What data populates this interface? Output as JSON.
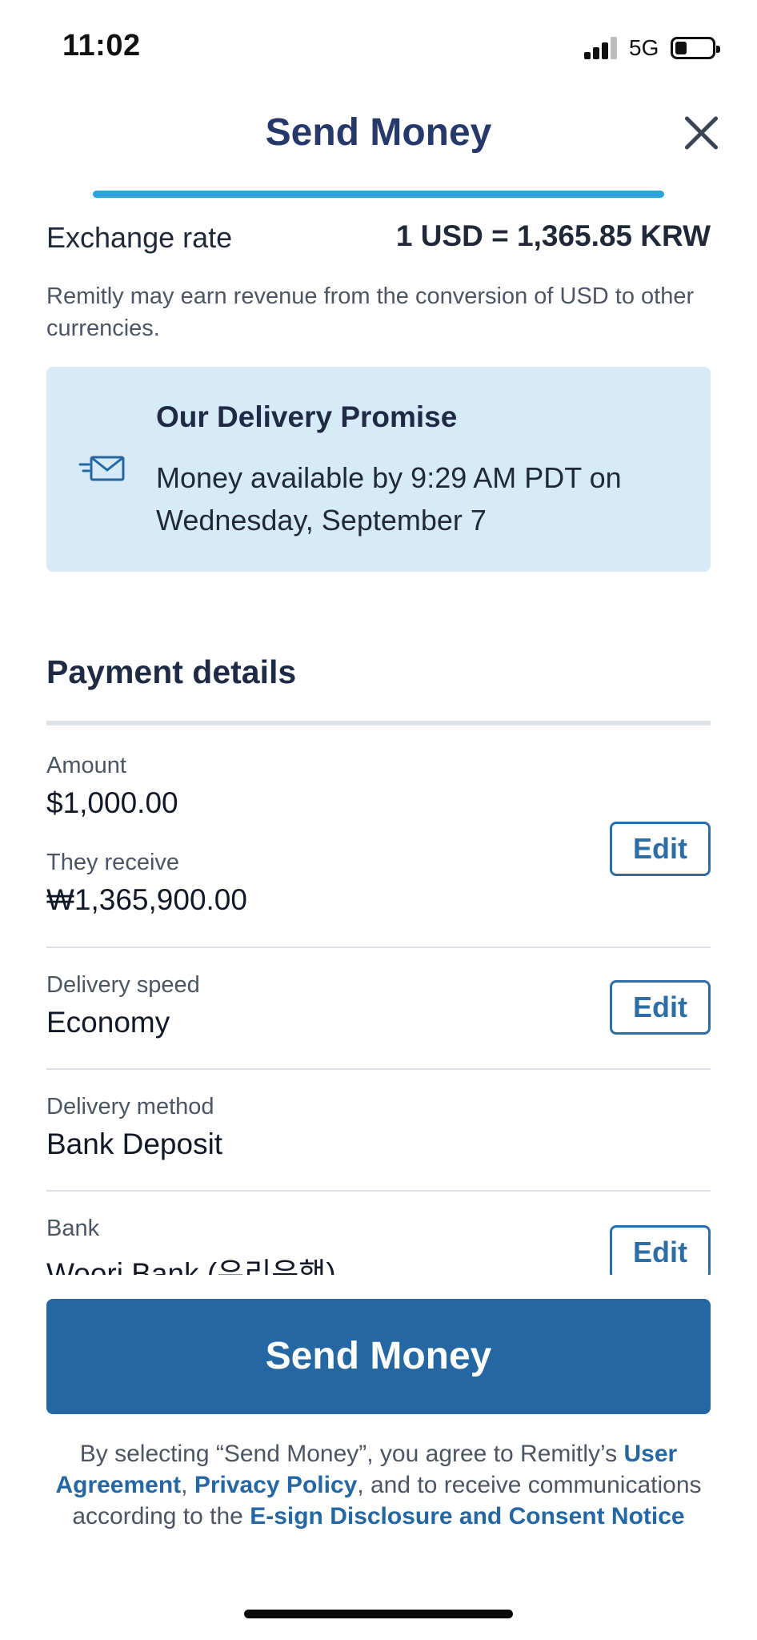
{
  "status_bar": {
    "time": "11:02",
    "network": "5G"
  },
  "header": {
    "title": "Send Money",
    "close_icon": "close-icon"
  },
  "exchange": {
    "label": "Exchange rate",
    "value": "1 USD = 1,365.85 KRW",
    "note": "Remitly may earn revenue from the conversion of USD to other currencies."
  },
  "delivery_promise": {
    "icon": "envelope-speed-icon",
    "title": "Our Delivery Promise",
    "text": "Money available by 9:29 AM PDT on Wednesday, September 7"
  },
  "payment_details": {
    "title": "Payment details",
    "amount_label": "Amount",
    "amount_value": "$1,000.00",
    "receive_label": "They receive",
    "receive_value": "₩1,365,900.00",
    "speed_label": "Delivery speed",
    "speed_value": "Economy",
    "method_label": "Delivery method",
    "method_value": "Bank Deposit",
    "bank_label": "Bank",
    "bank_value": "Woori Bank (우리은행)",
    "edit_label": "Edit"
  },
  "actions": {
    "send_label": "Send Money"
  },
  "legal": {
    "prefix": "By selecting “Send Money”, you agree to Remitly’s ",
    "link_user_agreement": "User Agreement",
    "sep1": ", ",
    "link_privacy": "Privacy Policy",
    "middle": ", and to receive communications according to the ",
    "link_esign": "E-sign Disclosure and Consent Notice"
  },
  "colors": {
    "title": "#27386a",
    "accent": "#2467a2",
    "progress": "#2aa2dd",
    "promise_bg": "#d7eaf8"
  }
}
